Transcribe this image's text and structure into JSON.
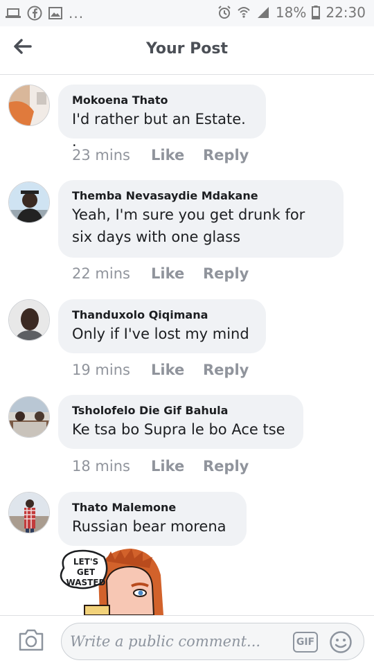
{
  "status_bar": {
    "battery": "18%",
    "time": "22:30",
    "more": "..."
  },
  "header": {
    "title": "Your Post"
  },
  "comments": [
    {
      "author": "Mokoena Thato",
      "text": "I'd rather but an Estate. .",
      "time": "23 mins",
      "like": "Like",
      "reply": "Reply"
    },
    {
      "author": "Themba Nevasaydie Mdakane",
      "text": "Yeah, I'm sure you get drunk for six days with one glass",
      "time": "22 mins",
      "like": "Like",
      "reply": "Reply"
    },
    {
      "author": "Thanduxolo Qiqimana",
      "text": "Only if I've lost my mind",
      "time": "19 mins",
      "like": "Like",
      "reply": "Reply"
    },
    {
      "author": "Tsholofelo Die Gif Bahula",
      "text": "Ke tsa bo Supra le bo Ace tse",
      "time": "18 mins",
      "like": "Like",
      "reply": "Reply"
    },
    {
      "author": "Thato Malemone",
      "text": "Russian bear morena"
    }
  ],
  "sticker": {
    "text": "LET'S GET WASTED"
  },
  "composer": {
    "placeholder": "Write a public comment...",
    "gif_label": "GIF"
  },
  "colors": {
    "bubble": "#f0f2f5",
    "meta": "#90949c",
    "title": "#4b4f56"
  }
}
